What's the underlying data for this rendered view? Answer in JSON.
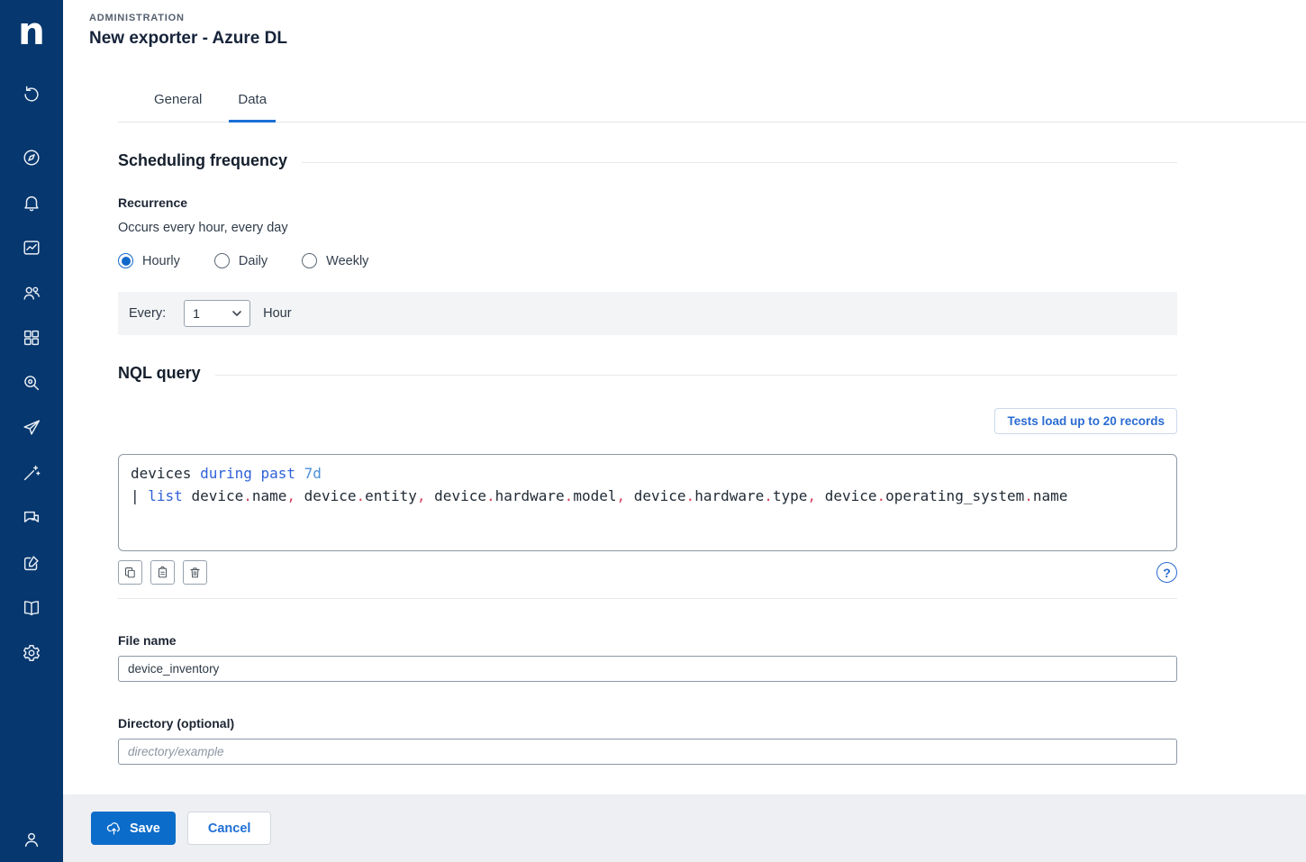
{
  "brand": {
    "logo_letter": "n"
  },
  "colors": {
    "sidebar_bg": "#06376e",
    "accent_blue": "#0c6cc9",
    "link_blue": "#2a6bd2",
    "keyword_blue": "#2f62d8",
    "duration_blue": "#4b8fd6",
    "punctuation_red": "#d8415f",
    "footer_bg": "#edeff2"
  },
  "sidebar": {
    "items": [
      {
        "icon": "refresh-icon"
      },
      {
        "icon": "compass-icon"
      },
      {
        "icon": "bell-icon"
      },
      {
        "icon": "chart-icon"
      },
      {
        "icon": "users-icon"
      },
      {
        "icon": "grid-icon"
      },
      {
        "icon": "search-icon"
      },
      {
        "icon": "act-icon"
      },
      {
        "icon": "wand-icon"
      },
      {
        "icon": "chat-icon"
      },
      {
        "icon": "edit-icon"
      },
      {
        "icon": "book-icon"
      },
      {
        "icon": "gear-icon"
      }
    ],
    "bottom": {
      "icon": "user-icon"
    }
  },
  "header": {
    "eyebrow": "ADMINISTRATION",
    "title": "New exporter - Azure DL"
  },
  "tabs": {
    "items": [
      {
        "label": "General"
      },
      {
        "label": "Data"
      }
    ],
    "active_index": 1
  },
  "scheduling": {
    "title": "Scheduling frequency",
    "recurrence_label": "Recurrence",
    "summary": "Occurs every hour, every day",
    "recurrence_options": [
      {
        "label": "Hourly",
        "selected": true
      },
      {
        "label": "Daily",
        "selected": false
      },
      {
        "label": "Weekly",
        "selected": false
      }
    ],
    "every_label": "Every:",
    "every_value": "1",
    "every_unit": "Hour"
  },
  "nql": {
    "title": "NQL query",
    "tests_button_label": "Tests load up to 20 records",
    "toolbar_icons": [
      "copy-icon",
      "paste-icon",
      "trash-icon"
    ],
    "help_icon": "help-icon",
    "lines": [
      [
        {
          "t": "devices ",
          "c": "id"
        },
        {
          "t": "during past ",
          "c": "kw"
        },
        {
          "t": "7d",
          "c": "num"
        }
      ],
      [
        {
          "t": "| ",
          "c": "id"
        },
        {
          "t": "list ",
          "c": "kw"
        },
        {
          "t": "device",
          "c": "id"
        },
        {
          "t": ".",
          "c": "p"
        },
        {
          "t": "name",
          "c": "id"
        },
        {
          "t": ", ",
          "c": "p"
        },
        {
          "t": "device",
          "c": "id"
        },
        {
          "t": ".",
          "c": "p"
        },
        {
          "t": "entity",
          "c": "id"
        },
        {
          "t": ", ",
          "c": "p"
        },
        {
          "t": "device",
          "c": "id"
        },
        {
          "t": ".",
          "c": "p"
        },
        {
          "t": "hardware",
          "c": "id"
        },
        {
          "t": ".",
          "c": "p"
        },
        {
          "t": "model",
          "c": "id"
        },
        {
          "t": ", ",
          "c": "p"
        },
        {
          "t": "device",
          "c": "id"
        },
        {
          "t": ".",
          "c": "p"
        },
        {
          "t": "hardware",
          "c": "id"
        },
        {
          "t": ".",
          "c": "p"
        },
        {
          "t": "type",
          "c": "id"
        },
        {
          "t": ", ",
          "c": "p"
        },
        {
          "t": "device",
          "c": "id"
        },
        {
          "t": ".",
          "c": "p"
        },
        {
          "t": "operating_system",
          "c": "id"
        },
        {
          "t": ".",
          "c": "p"
        },
        {
          "t": "name",
          "c": "id"
        }
      ]
    ]
  },
  "file_name": {
    "label": "File name",
    "value": "device_inventory"
  },
  "directory": {
    "label": "Directory (optional)",
    "placeholder": "directory/example"
  },
  "footer": {
    "save_label": "Save",
    "cancel_label": "Cancel"
  },
  "help_label": "?"
}
